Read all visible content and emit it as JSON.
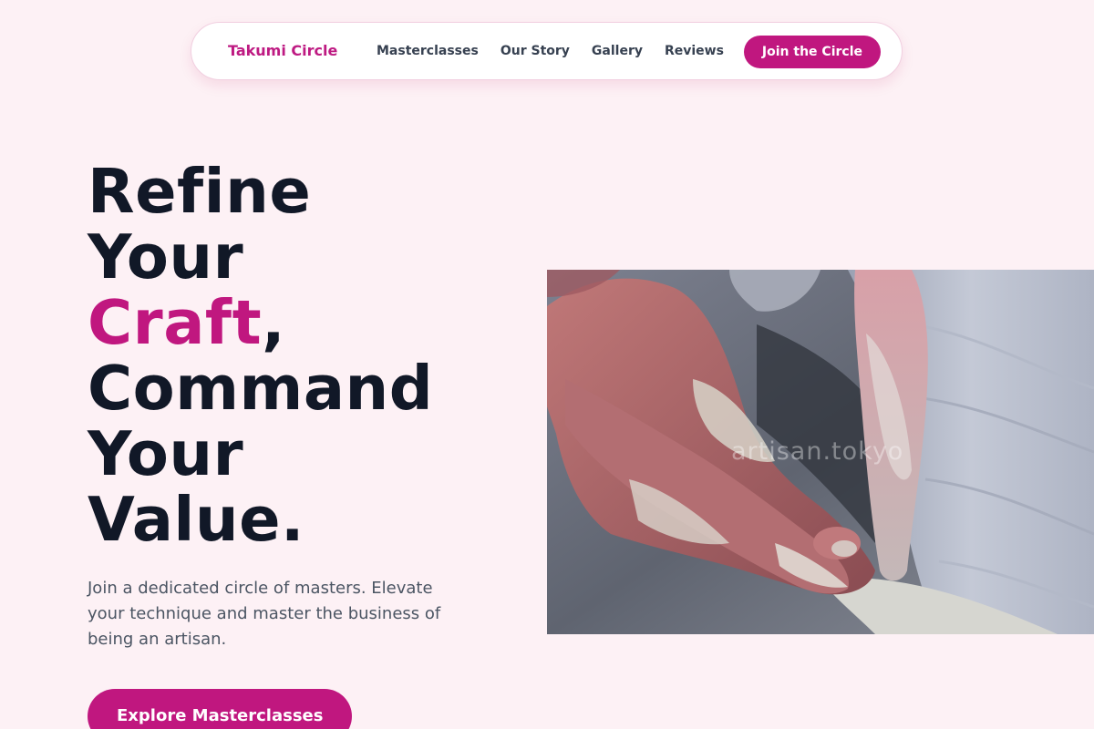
{
  "nav": {
    "brand": "Takumi Circle",
    "links": [
      "Masterclasses",
      "Our Story",
      "Gallery",
      "Reviews"
    ],
    "cta": "Join the Circle"
  },
  "hero": {
    "line1": "Refine",
    "line2": "Your",
    "accent_word": "Craft",
    "accent_punct": ",",
    "line4": "Command",
    "line5": "Your",
    "line6": "Value.",
    "subtext": "Join a dedicated circle of masters. Elevate your technique and master the business of being an artisan.",
    "cta": "Explore Masterclasses"
  },
  "photo": {
    "alt": "Clay-covered hands shaping pottery on a wheel",
    "watermark": "artisan.tokyo"
  },
  "colors": {
    "background": "#fdf1f5",
    "accent": "#c0177f",
    "heading": "#111827",
    "body_text": "#4b5563"
  }
}
